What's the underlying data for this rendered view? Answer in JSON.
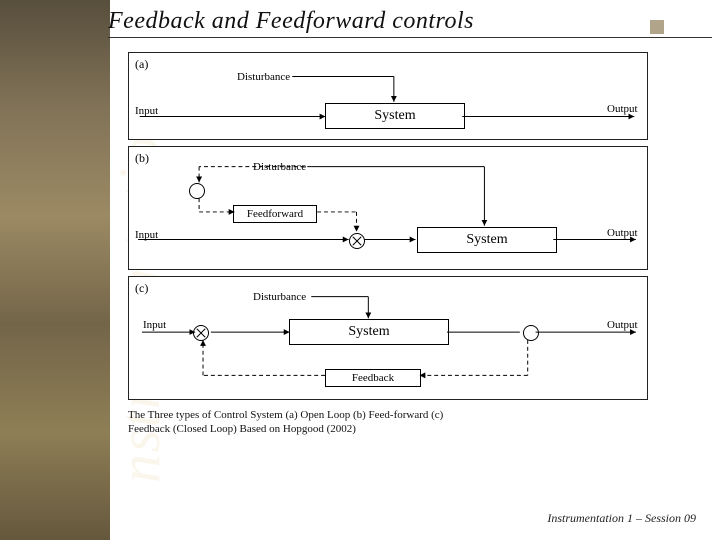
{
  "title": "Feedback and Feedforward controls",
  "bg_word": "nstrumentation",
  "panels": {
    "a": {
      "tag": "(a)",
      "input": "Input",
      "disturbance": "Disturbance",
      "output": "Output",
      "system": "System"
    },
    "b": {
      "tag": "(b)",
      "input": "Input",
      "disturbance": "Disturbance",
      "output": "Output",
      "system": "System",
      "feedforward": "Feedforward"
    },
    "c": {
      "tag": "(c)",
      "input": "Input",
      "disturbance": "Disturbance",
      "output": "Output",
      "system": "System",
      "feedback": "Feedback"
    }
  },
  "caption": "The Three types of Control System (a) Open Loop (b) Feed-forward (c) Feedback (Closed Loop) Based on Hopgood (2002)",
  "footer": "Instrumentation 1 – Session 09"
}
